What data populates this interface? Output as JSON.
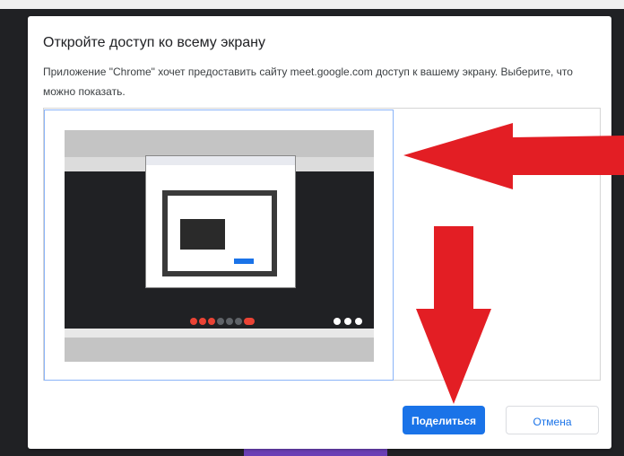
{
  "dialog": {
    "title": "Откройте доступ ко всему экрану",
    "description": "Приложение \"Chrome\" хочет предоставить сайту meet.google.com доступ к вашему экрану. Выберите, что можно показать.",
    "share_button": "Поделиться",
    "cancel_button": "Отмена"
  },
  "colors": {
    "primary": "#1a73e8",
    "annotation_arrow": "#e31e24",
    "backdrop": "#202124"
  }
}
